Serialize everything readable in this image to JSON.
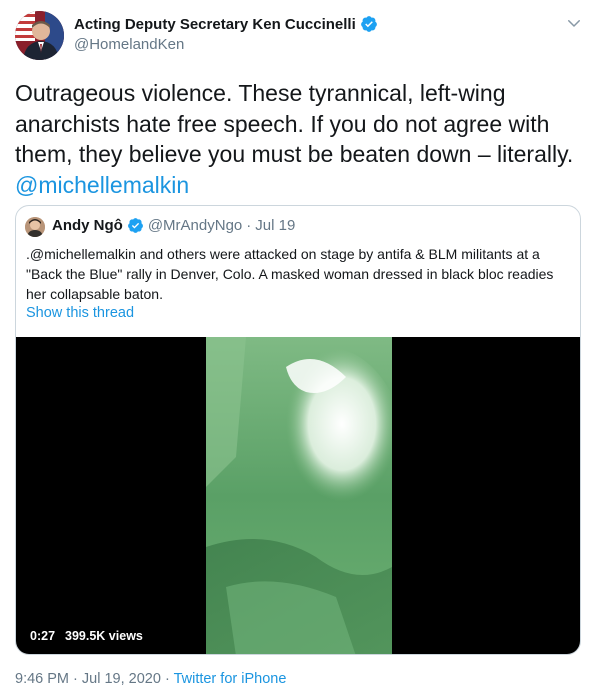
{
  "author": {
    "name": "Acting Deputy Secretary Ken Cuccinelli",
    "handle": "@HomelandKen",
    "verified_icon": "verified-badge-icon"
  },
  "tweet": {
    "text": "Outrageous violence. These tyrannical, left-wing anarchists hate free speech. If you do not agree with them, they believe you must be beaten down – literally.",
    "mention": "@michellemalkin"
  },
  "quoted_tweet": {
    "name": "Andy Ngô",
    "handle": "@MrAndyNgo",
    "separator": "·",
    "date": "Jul 19",
    "text": ".@michellemalkin and others were attacked on stage by antifa & BLM militants at a \"Back the Blue\" rally in Denver, Colo. A masked woman dressed in black bloc readies her collapsable baton.",
    "show_thread": "Show this thread",
    "video": {
      "duration": "0:27",
      "views": "399.5K views"
    }
  },
  "meta": {
    "time": "9:46 PM · Jul 19, 2020",
    "separator": "·",
    "source": "Twitter for iPhone"
  },
  "colors": {
    "link": "#1b95e0",
    "secondary_text": "#657786",
    "border": "#ccd6dd",
    "video_green": "#5fa56a"
  }
}
